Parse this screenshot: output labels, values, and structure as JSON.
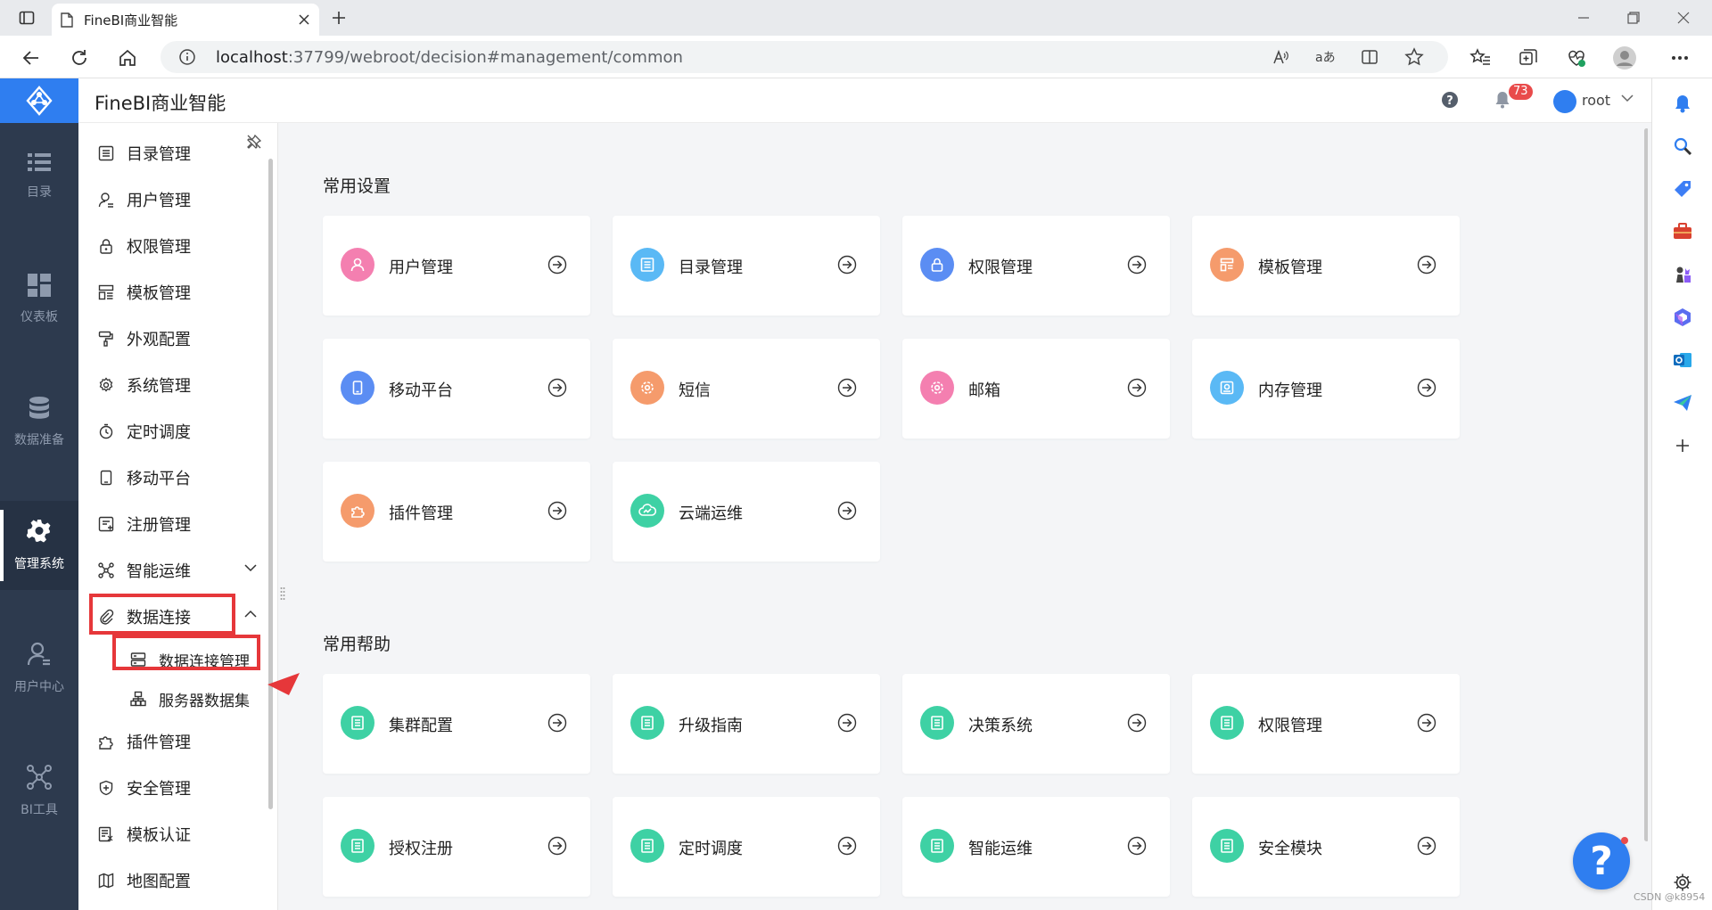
{
  "browser": {
    "tab_title": "FineBI商业智能",
    "url_host": "localhost",
    "url_rest": ":37799/webroot/decision#management/common"
  },
  "rail": {
    "items": [
      {
        "label": "目录",
        "icon": "list-icon"
      },
      {
        "label": "仪表板",
        "icon": "dashboard-icon"
      },
      {
        "label": "数据准备",
        "icon": "database-icon"
      },
      {
        "label": "管理系统",
        "icon": "gear-icon",
        "active": true
      },
      {
        "label": "用户中心",
        "icon": "user-icon"
      },
      {
        "label": "BI工具",
        "icon": "network-icon"
      }
    ]
  },
  "header": {
    "title": "FineBI商业智能",
    "notification_count": "73",
    "username": "root"
  },
  "menu": {
    "items": [
      {
        "label": "目录管理"
      },
      {
        "label": "用户管理"
      },
      {
        "label": "权限管理"
      },
      {
        "label": "模板管理"
      },
      {
        "label": "外观配置"
      },
      {
        "label": "系统管理"
      },
      {
        "label": "定时调度"
      },
      {
        "label": "移动平台"
      },
      {
        "label": "注册管理"
      },
      {
        "label": "智能运维"
      },
      {
        "label": "数据连接"
      },
      {
        "label": "数据连接管理"
      },
      {
        "label": "服务器数据集"
      },
      {
        "label": "插件管理"
      },
      {
        "label": "安全管理"
      },
      {
        "label": "模板认证"
      },
      {
        "label": "地图配置"
      }
    ]
  },
  "main": {
    "common_settings": {
      "title": "常用设置",
      "cards": [
        {
          "label": "用户管理",
          "icon": "user-icon",
          "color": "#f47fb0"
        },
        {
          "label": "目录管理",
          "icon": "catalog-icon",
          "color": "#5ab9f5"
        },
        {
          "label": "权限管理",
          "icon": "lock-icon",
          "color": "#5b8df3"
        },
        {
          "label": "模板管理",
          "icon": "template-icon",
          "color": "#f59b6c"
        },
        {
          "label": "移动平台",
          "icon": "mobile-icon",
          "color": "#5b8df3"
        },
        {
          "label": "短信",
          "icon": "gear-icon",
          "color": "#f59b6c"
        },
        {
          "label": "邮箱",
          "icon": "gear-icon",
          "color": "#f47fb0"
        },
        {
          "label": "内存管理",
          "icon": "memory-icon",
          "color": "#5ab9f5"
        },
        {
          "label": "插件管理",
          "icon": "puzzle-icon",
          "color": "#f59b6c"
        },
        {
          "label": "云端运维",
          "icon": "cloud-icon",
          "color": "#3ed1a4"
        }
      ]
    },
    "common_help": {
      "title": "常用帮助",
      "cards": [
        {
          "label": "集群配置",
          "icon": "doc-icon",
          "color": "#3ed1a4"
        },
        {
          "label": "升级指南",
          "icon": "doc-icon",
          "color": "#3ed1a4"
        },
        {
          "label": "决策系统",
          "icon": "doc-icon",
          "color": "#3ed1a4"
        },
        {
          "label": "权限管理",
          "icon": "doc-icon",
          "color": "#3ed1a4"
        },
        {
          "label": "授权注册",
          "icon": "doc-icon",
          "color": "#3ed1a4"
        },
        {
          "label": "定时调度",
          "icon": "doc-icon",
          "color": "#3ed1a4"
        },
        {
          "label": "智能运维",
          "icon": "doc-icon",
          "color": "#3ed1a4"
        },
        {
          "label": "安全模块",
          "icon": "doc-icon",
          "color": "#3ed1a4"
        }
      ]
    }
  },
  "float_help_label": "?",
  "watermark": "CSDN @k8954",
  "colors": {
    "accent": "#2f7ef0",
    "rail": "#2d3a4e",
    "highlight": "#e6373a"
  }
}
